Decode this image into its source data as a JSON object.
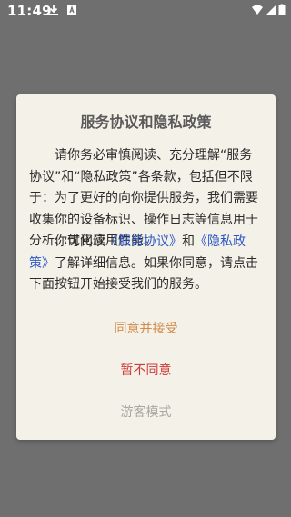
{
  "status_bar": {
    "time": "11:49",
    "icons": [
      "download-icon",
      "notification-icon",
      "wifi-icon",
      "signal-icon",
      "battery-icon"
    ]
  },
  "dialog": {
    "title": "服务协议和隐私政策",
    "paragraph1": "请你务必审慎阅读、充分理解“服务协议”和“隐私政策”各条款，包括但不限于：为了更好的向你提供服务，我们需要收集你的设备标识、操作日志等信息用于分析、优化应用性能。",
    "paragraph2": {
      "prefix": "你可阅读",
      "link1": "《服务协议》",
      "middle": "和",
      "link2": "《隐私政策》",
      "suffix": "了解详细信息。如果你同意，请点击下面按钮开始接受我们的服务。"
    },
    "buttons": {
      "agree": "同意并接受",
      "disagree": "暂不同意",
      "guest": "游客模式"
    }
  },
  "colors": {
    "overlay": "#6f6f6f",
    "dialog_bg": "#f4f1e8",
    "link": "#2b57c8",
    "agree": "#d28b4a",
    "disagree": "#cf3b3b",
    "guest": "#a9a7a2"
  }
}
